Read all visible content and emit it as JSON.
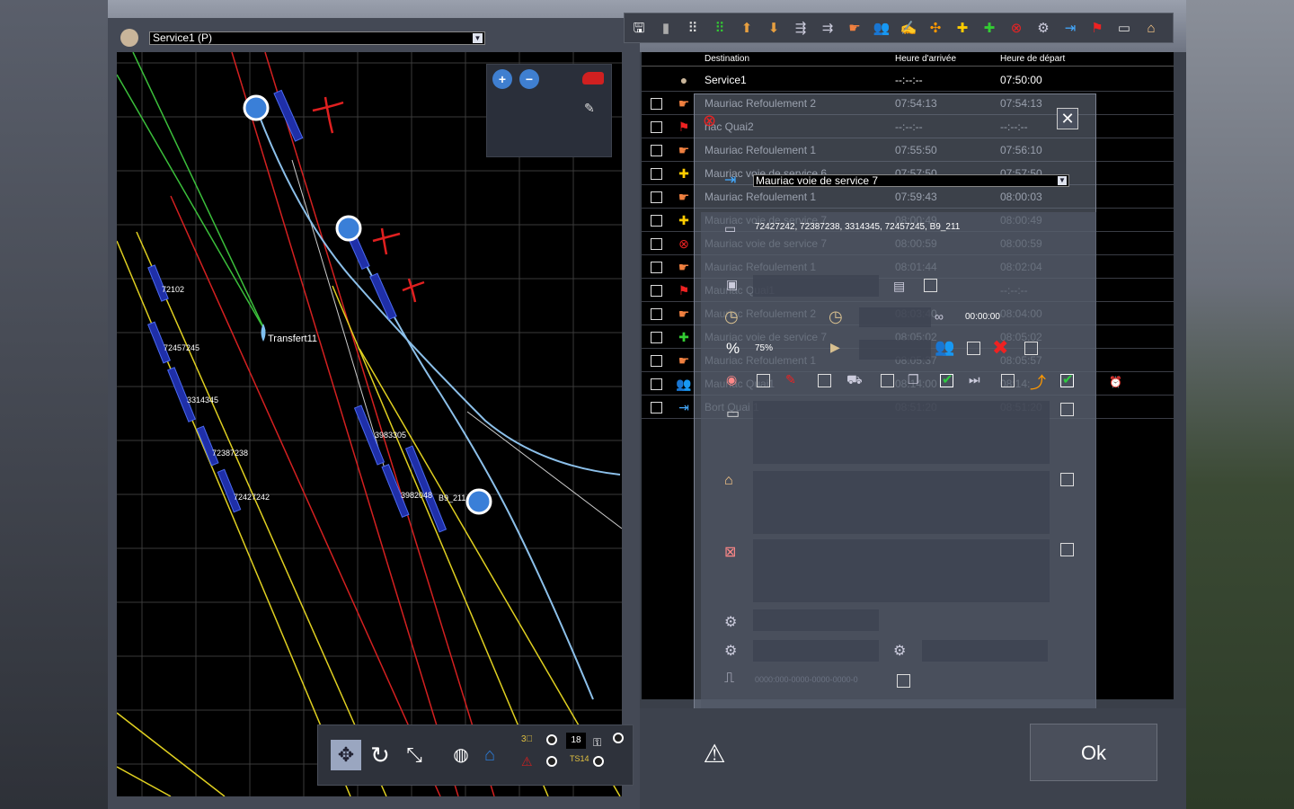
{
  "map": {
    "service_select": "Service1 (P)",
    "labels": [
      {
        "text": "72102"
      },
      {
        "text": "72457245"
      },
      {
        "text": "3314345"
      },
      {
        "text": "72387238"
      },
      {
        "text": "72427242"
      },
      {
        "text": "3983305"
      },
      {
        "text": "3982048"
      },
      {
        "text": "B9_211"
      }
    ],
    "transfer_label": "Transfert11",
    "speed_value": "18",
    "speed_tag": "TS14"
  },
  "toolbar": {
    "icons": [
      "save-icon",
      "trash-icon",
      "grid-dots-icon",
      "grid-green-icon",
      "move-up-icon",
      "move-down-icon",
      "split-icon",
      "merge-icon",
      "hand-icon",
      "people-icon",
      "sign-icon",
      "swap-icon",
      "add-orange-icon",
      "add-green-icon",
      "remove-loco-icon",
      "settings-icon",
      "enter-icon",
      "flag-icon",
      "wagon-icon",
      "platform-icon"
    ]
  },
  "table": {
    "headers": {
      "destination": "Destination",
      "arrival": "Heure d'arrivée",
      "departure": "Heure de départ"
    },
    "service_row": {
      "destination": "Service1",
      "arrival": "--:--:--",
      "departure": "07:50:00"
    },
    "rows": [
      {
        "icon": "hand-icon",
        "destination": "Mauriac Refoulement 2",
        "arrival": "07:54:13",
        "departure": "07:54:13"
      },
      {
        "icon": "flag-icon",
        "destination": "riac Quai2",
        "arrival": "--:--:--",
        "departure": "--:--:--"
      },
      {
        "icon": "hand-icon",
        "destination": "Mauriac Refoulement 1",
        "arrival": "07:55:50",
        "departure": "07:56:10"
      },
      {
        "icon": "add-orange-icon",
        "destination": "Mauriac voie de service 6",
        "arrival": "07:57:50",
        "departure": "07:57:50"
      },
      {
        "icon": "hand-icon",
        "destination": "Mauriac Refoulement 1",
        "arrival": "07:59:43",
        "departure": "08:00:03"
      },
      {
        "icon": "add-orange-icon",
        "destination": "Mauriac voie de service 7",
        "arrival": "08:00:49",
        "departure": "08:00:49"
      },
      {
        "icon": "remove-loco-icon",
        "destination": "Mauriac voie de service 7",
        "arrival": "08:00:59",
        "departure": "08:00:59"
      },
      {
        "icon": "hand-icon",
        "destination": "Mauriac Refoulement 1",
        "arrival": "08:01:44",
        "departure": "08:02:04"
      },
      {
        "icon": "flag-icon",
        "destination": "Mauriac Quai1",
        "arrival": "",
        "departure": "--:--:--"
      },
      {
        "icon": "hand-icon",
        "destination": "Mauriac Refoulement 2",
        "arrival": "08:03:40",
        "departure": "08:04:00"
      },
      {
        "icon": "add-green-icon",
        "destination": "Mauriac voie de service 7",
        "arrival": "08:05:02",
        "departure": "08:05:02"
      },
      {
        "icon": "hand-icon",
        "destination": "Mauriac Refoulement 1",
        "arrival": "08:05:37",
        "departure": "08:05:57"
      },
      {
        "icon": "people-icon",
        "destination": "Mauriac Quai1",
        "arrival": "08:14:00",
        "departure": "08:14:"
      },
      {
        "icon": "enter-icon",
        "destination": "Bort Quai 1",
        "arrival": "08:51:20",
        "departure": "08:51:20"
      }
    ]
  },
  "popup": {
    "destination_select": "Mauriac  voie de service 7",
    "consist": "72427242, 72387238, 3314345, 72457245, B9_211",
    "time_value": "00:00:00",
    "percent_value": "75%",
    "field_placeholder": "0000:000-0000-0000-0000-0"
  },
  "footer": {
    "ok_label": "Ok"
  }
}
